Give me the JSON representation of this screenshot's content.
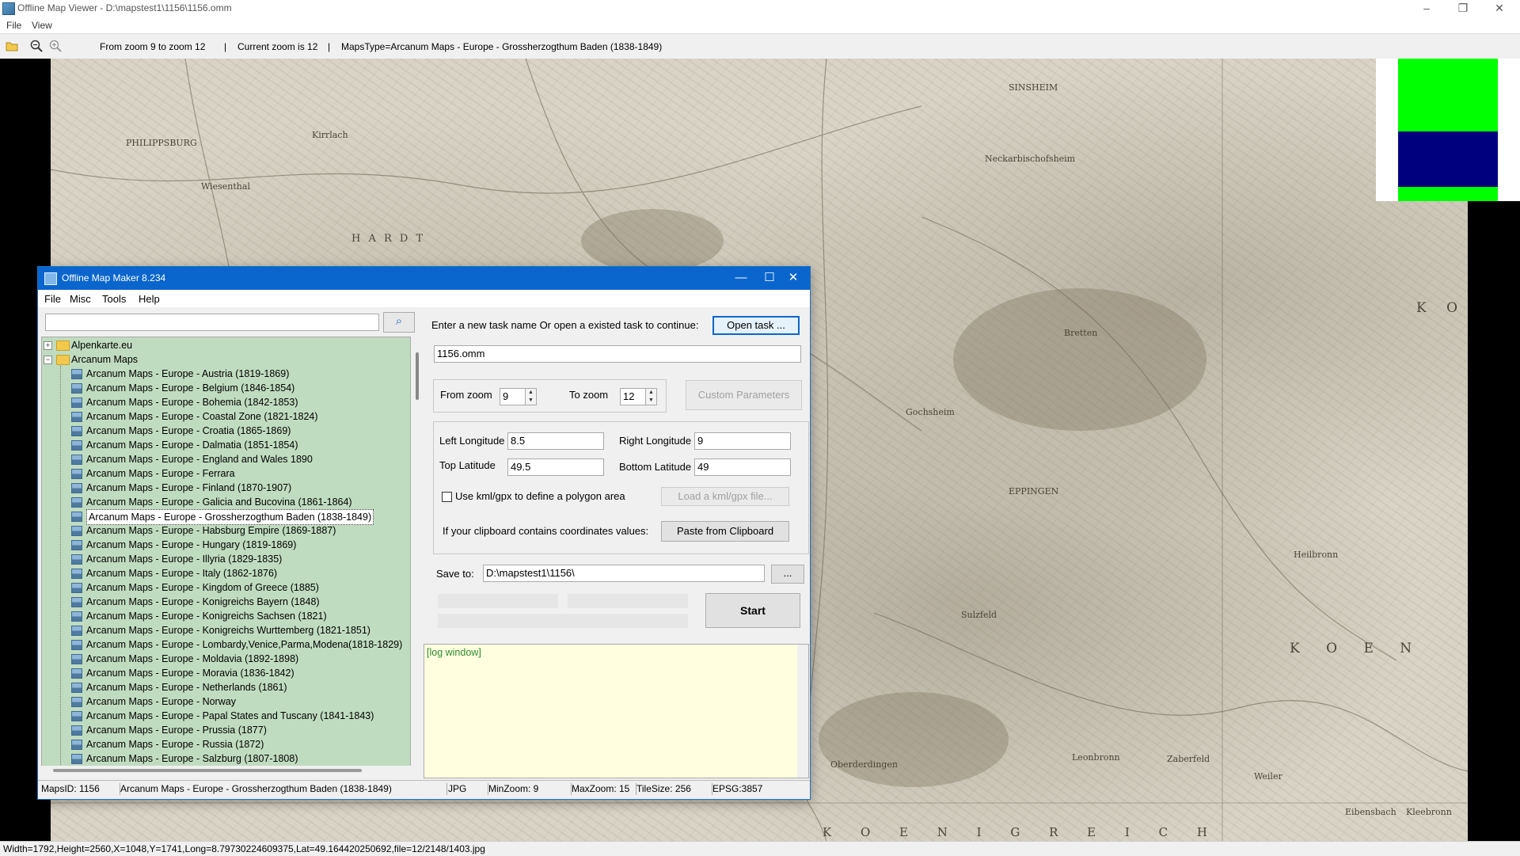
{
  "window": {
    "title": "Offline Map Viewer - D:\\mapstest1\\1156\\1156.omm",
    "minimize": "–",
    "maximize": "❐",
    "close": "✕"
  },
  "menu": [
    "File",
    "View"
  ],
  "toolbar": {
    "zoom_range": "From zoom 9 to zoom 12",
    "current_zoom": "Current zoom is 12",
    "maps_type": "MapsType=Arcanum Maps - Europe - Grossherzogthum Baden (1838-1849)",
    "sep": "|"
  },
  "map": {
    "labels": [
      "PHILIPPSBURG",
      "Wiesenthal",
      "H A R D T",
      "SINSHEIM",
      "EPPINGEN",
      "K O",
      "K O E N",
      "K O E N I G R E I C H",
      "Sulzfeld",
      "Heilbronn",
      "Weiler",
      "Kirrlach",
      "Neckarbischofsheim",
      "Bretten",
      "Gochsheim",
      "Oberderdingen",
      "Leonbronn",
      "Zaberfeld",
      "Eibensbach",
      "Kleebronn"
    ]
  },
  "statusbar": "Width=1792,Height=2560,X=1048,Y=1741,Long=8.79730224609375,Lat=49.164420250692,file=12/2148/1403.jpg",
  "dialog": {
    "title": "Offline Map Maker 8.234",
    "minimize": "—",
    "maximize": "☐",
    "close": "✕",
    "menu": [
      "File",
      "Misc",
      "Tools",
      "Help"
    ],
    "search_value": "",
    "tree": {
      "roots": [
        {
          "label": "Alpenkarte.eu",
          "expanded": false
        },
        {
          "label": "Arcanum Maps",
          "expanded": true
        }
      ],
      "children": [
        "Arcanum Maps - Europe - Austria (1819-1869)",
        "Arcanum Maps - Europe - Belgium (1846-1854)",
        "Arcanum Maps - Europe - Bohemia (1842-1853)",
        "Arcanum Maps - Europe - Coastal Zone (1821-1824)",
        "Arcanum Maps - Europe - Croatia (1865-1869)",
        "Arcanum Maps - Europe - Dalmatia (1851-1854)",
        "Arcanum Maps - Europe - England and Wales 1890",
        "Arcanum Maps - Europe - Ferrara",
        "Arcanum Maps - Europe - Finland (1870-1907)",
        "Arcanum Maps - Europe - Galicia and Bucovina (1861-1864)",
        "Arcanum Maps - Europe - Grossherzogthum Baden (1838-1849)",
        "Arcanum Maps - Europe - Habsburg Empire (1869-1887)",
        "Arcanum Maps - Europe - Hungary (1819-1869)",
        "Arcanum Maps - Europe - Illyria (1829-1835)",
        "Arcanum Maps - Europe - Italy (1862-1876)",
        "Arcanum Maps - Europe - Kingdom of Greece (1885)",
        "Arcanum Maps - Europe - Konigreichs Bayern (1848)",
        "Arcanum Maps - Europe - Konigreichs Sachsen (1821)",
        "Arcanum Maps - Europe - Konigreichs Wurttemberg (1821-1851)",
        "Arcanum Maps - Europe - Lombardy,Venice,Parma,Modena(1818-1829)",
        "Arcanum Maps - Europe - Moldavia (1892-1898)",
        "Arcanum Maps - Europe - Moravia (1836-1842)",
        "Arcanum Maps - Europe - Netherlands (1861)",
        "Arcanum Maps - Europe - Norway",
        "Arcanum Maps - Europe - Papal States and Tuscany (1841-1843)",
        "Arcanum Maps - Europe - Prussia (1877)",
        "Arcanum Maps - Europe - Russia (1872)",
        "Arcanum Maps - Europe - Salzburg (1807-1808)"
      ],
      "selected_index": 10
    },
    "task_prompt": "Enter a new task name Or open a existed task to continue:",
    "open_task": "Open task ...",
    "task_name": "1156.omm",
    "from_zoom_label": "From zoom",
    "from_zoom": "9",
    "to_zoom_label": "To zoom",
    "to_zoom": "12",
    "custom_params": "Custom Parameters",
    "left_lon_label": "Left Longitude",
    "left_lon": "8.5",
    "right_lon_label": "Right Longitude",
    "right_lon": "9",
    "top_lat_label": "Top Latitude",
    "top_lat": "49.5",
    "bottom_lat_label": "Bottom Latitude",
    "bottom_lat": "49",
    "kml_checkbox": "Use kml/gpx to define a polygon area",
    "load_kml": "Load a kml/gpx file...",
    "clipboard_prompt": "If your clipboard contains coordinates values:",
    "paste_clipboard": "Paste from Clipboard",
    "save_to_label": "Save to:",
    "save_to": "D:\\mapstest1\\1156\\",
    "browse": "...",
    "start": "Start",
    "log": "[log window]",
    "status": {
      "maps_id": "MapsID: 1156",
      "name": "Arcanum Maps - Europe - Grossherzogthum Baden (1838-1849)",
      "format": "JPG",
      "min_zoom": "MinZoom: 9",
      "max_zoom": "MaxZoom: 15",
      "tile_size": "TileSize: 256",
      "epsg": "EPSG:3857"
    }
  },
  "colors": {
    "legend_green": "#00ff00",
    "legend_blue": "#00007f",
    "tree_bg": "#c0dcc0",
    "log_bg": "#ffffe0",
    "dialog_title": "#0a66cc"
  }
}
